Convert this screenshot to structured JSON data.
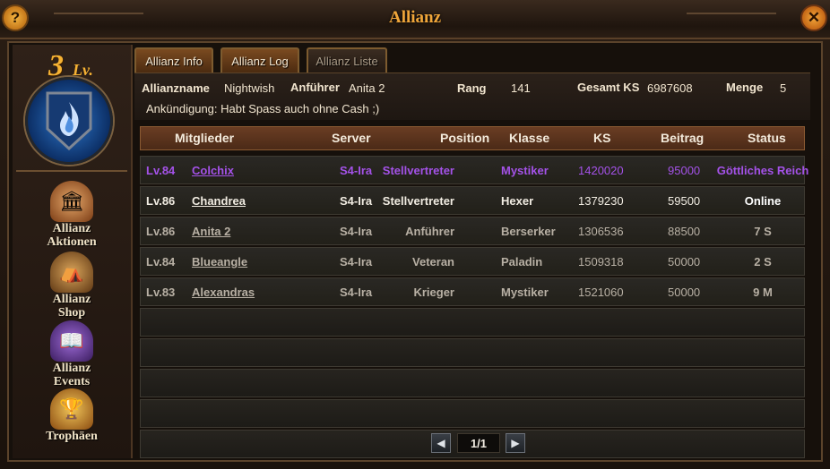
{
  "window": {
    "title": "Allianz",
    "help_glyph": "?",
    "close_glyph": "✕"
  },
  "level": {
    "number": "3",
    "suffix": "Lv."
  },
  "sidebar": {
    "items": [
      {
        "line1": "Allianz",
        "line2": "Aktionen",
        "icon": "chest-icon"
      },
      {
        "line1": "Allianz",
        "line2": "Shop",
        "icon": "shop-icon"
      },
      {
        "line1": "Allianz",
        "line2": "Events",
        "icon": "events-icon"
      },
      {
        "line1": "Trophäen",
        "line2": "",
        "icon": "trophy-icon"
      }
    ]
  },
  "tabs": [
    {
      "label": "Allianz Info",
      "active": true
    },
    {
      "label": "Allianz Log",
      "active": true
    },
    {
      "label": "Allianz Liste",
      "active": false
    }
  ],
  "info": {
    "name_label": "Allianzname",
    "name_value": "Nightwish",
    "leader_label": "Anführer",
    "leader_value": "Anita 2",
    "rank_label": "Rang",
    "rank_value": "141",
    "total_ks_label": "Gesamt KS",
    "total_ks_value": "6987608",
    "count_label": "Menge",
    "count_value": "5",
    "announcement": "Ankündigung: Habt Spass auch ohne Cash ;)"
  },
  "table": {
    "headers": [
      "Mitglieder",
      "Server",
      "Position",
      "Klasse",
      "KS",
      "Beitrag",
      "Status"
    ],
    "rows": [
      {
        "level": "Lv.84",
        "name": "Colchix",
        "server": "S4-Ira",
        "position": "Stellvertreter",
        "klasse": "Mystiker",
        "ks": "1420020",
        "beitrag": "95000",
        "status": "Göttliches Reich",
        "highlight": true
      },
      {
        "level": "Lv.86",
        "name": "Chandrea",
        "server": "S4-Ira",
        "position": "Stellvertreter",
        "klasse": "Hexer",
        "ks": "1379230",
        "beitrag": "59500",
        "status": "Online",
        "highlight": false,
        "online": true
      },
      {
        "level": "Lv.86",
        "name": "Anita 2",
        "server": "S4-Ira",
        "position": "Anführer",
        "klasse": "Berserker",
        "ks": "1306536",
        "beitrag": "88500",
        "status": "7 S",
        "highlight": false
      },
      {
        "level": "Lv.84",
        "name": "Blueangle",
        "server": "S4-Ira",
        "position": "Veteran",
        "klasse": "Paladin",
        "ks": "1509318",
        "beitrag": "50000",
        "status": "2 S",
        "highlight": false
      },
      {
        "level": "Lv.83",
        "name": "Alexandras",
        "server": "S4-Ira",
        "position": "Krieger",
        "klasse": "Mystiker",
        "ks": "1521060",
        "beitrag": "50000",
        "status": "9 M",
        "highlight": false
      }
    ],
    "empty_rows": 5
  },
  "pager": {
    "value": "1/1",
    "prev": "◀",
    "next": "▶"
  },
  "colors": {
    "accent": "#f0a63a",
    "highlight": "#a452e8",
    "text": "#e6ddcc",
    "muted": "#b8b0a4"
  }
}
